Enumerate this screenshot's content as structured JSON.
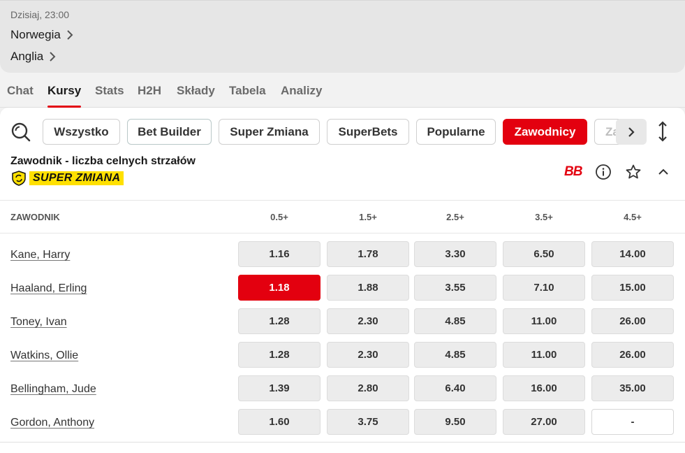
{
  "match": {
    "time": "Dzisiaj, 23:00",
    "home_team": "Norwegia",
    "away_team": "Anglia"
  },
  "tabs": [
    {
      "label": "Chat",
      "active": false
    },
    {
      "label": "Kursy",
      "active": true
    },
    {
      "label": "Stats",
      "active": false
    },
    {
      "label": "H2H",
      "active": false
    },
    {
      "label": "Składy",
      "active": false
    },
    {
      "label": "Tabela",
      "active": false
    },
    {
      "label": "Analizy",
      "active": false
    }
  ],
  "filters": {
    "search_icon": "search-icon",
    "chips": [
      {
        "label": "Wszystko",
        "active": false
      },
      {
        "label": "Bet Builder",
        "active": false
      },
      {
        "label": "Super Zmiana",
        "active": false
      },
      {
        "label": "SuperBets",
        "active": false
      },
      {
        "label": "Popularne",
        "active": false
      },
      {
        "label": "Zawodnicy",
        "active": true
      },
      {
        "label": "Za",
        "active": false
      }
    ],
    "scroll_icon": "chevron-right-icon",
    "expand_icon": "expand-vertical-icon"
  },
  "market": {
    "title": "Zawodnik - liczba celnych strzałów",
    "badge": "SUPER ZMIANA",
    "bb_label": "BB",
    "columns": [
      "ZAWODNIK",
      "0.5+",
      "1.5+",
      "2.5+",
      "3.5+",
      "4.5+"
    ],
    "rows": [
      {
        "player": "Kane, Harry",
        "odds": [
          "1.16",
          "1.78",
          "3.30",
          "6.50",
          "14.00"
        ]
      },
      {
        "player": "Haaland, Erling",
        "odds": [
          "1.18",
          "1.88",
          "3.55",
          "7.10",
          "15.00"
        ]
      },
      {
        "player": "Toney, Ivan",
        "odds": [
          "1.28",
          "2.30",
          "4.85",
          "11.00",
          "26.00"
        ]
      },
      {
        "player": "Watkins, Ollie",
        "odds": [
          "1.28",
          "2.30",
          "4.85",
          "11.00",
          "26.00"
        ]
      },
      {
        "player": "Bellingham, Jude",
        "odds": [
          "1.39",
          "2.80",
          "6.40",
          "16.00",
          "35.00"
        ]
      },
      {
        "player": "Gordon, Anthony",
        "odds": [
          "1.60",
          "3.75",
          "9.50",
          "27.00",
          "-"
        ]
      }
    ],
    "selected": {
      "row": 1,
      "col": 0
    }
  },
  "colors": {
    "accent": "#e3000f",
    "badge_yellow": "#ffe000"
  }
}
